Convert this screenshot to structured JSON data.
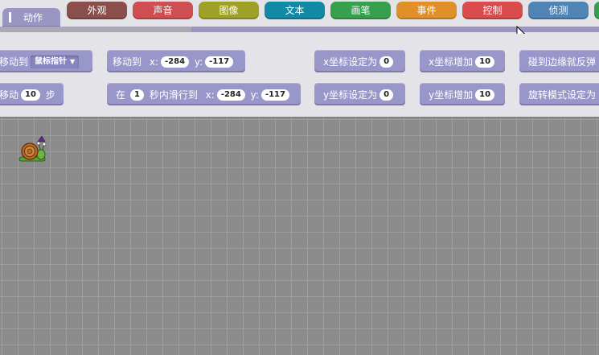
{
  "tabs": [
    {
      "label": "动作",
      "color": "#9a96c4",
      "active": true
    },
    {
      "label": "外观",
      "color": "#8a4f4b"
    },
    {
      "label": "声音",
      "color": "#cf4e51"
    },
    {
      "label": "图像",
      "color": "#9ea126"
    },
    {
      "label": "文本",
      "color": "#138aa5"
    },
    {
      "label": "画笔",
      "color": "#36a04f"
    },
    {
      "label": "事件",
      "color": "#e19029"
    },
    {
      "label": "控制",
      "color": "#d94b4c"
    },
    {
      "label": "侦测",
      "color": "#4f84b5"
    }
  ],
  "palette": {
    "move_to_target": {
      "label": "移动到",
      "option": "鼠标指针"
    },
    "move_to_xy": {
      "label": "移动到",
      "x_label": "x:",
      "x": "-284",
      "y_label": "y:",
      "y": "-117"
    },
    "set_x": {
      "label": "x坐标设定为",
      "value": "0"
    },
    "change_x": {
      "label": "x坐标增加",
      "value": "10"
    },
    "bounce": {
      "label": "碰到边缘就反弹"
    },
    "move_steps": {
      "label": "移动",
      "value": "10",
      "suffix": "步"
    },
    "glide": {
      "prefix": "在",
      "secs": "1",
      "middle": "秒内滑行到",
      "x_label": "x:",
      "x": "-284",
      "y_label": "y:",
      "y": "-117"
    },
    "set_y": {
      "label": "y坐标设定为",
      "value": "0"
    },
    "change_y": {
      "label": "y坐标增加",
      "value": "10"
    },
    "rotation": {
      "label": "旋转模式设定为"
    }
  },
  "icons": {
    "cursor": "mouse-pointer-icon",
    "sprite": "snail-sprite"
  }
}
